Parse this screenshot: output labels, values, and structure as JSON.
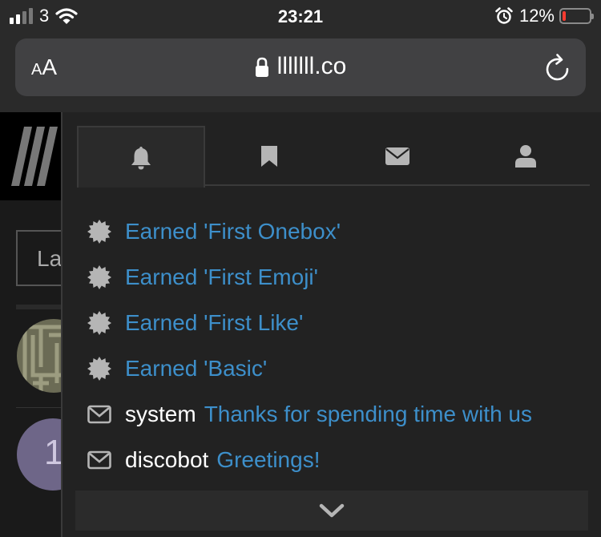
{
  "status_bar": {
    "carrier": "3",
    "time": "23:21",
    "battery_percent": "12%",
    "battery_level": 0.12,
    "signal_bars_active": 2,
    "signal_bars_total": 4
  },
  "browser": {
    "text_size_label_small": "A",
    "text_size_label_large": "A",
    "url": "lllllll.co"
  },
  "background_page": {
    "input_partial_text": "La",
    "avatar_number": "1"
  },
  "notifications_panel": {
    "tabs": [
      {
        "name": "notifications",
        "icon": "bell-icon",
        "active": true
      },
      {
        "name": "bookmarks",
        "icon": "bookmark-icon",
        "active": false
      },
      {
        "name": "messages",
        "icon": "envelope-icon",
        "active": false
      },
      {
        "name": "profile",
        "icon": "user-icon",
        "active": false
      }
    ],
    "items": [
      {
        "icon": "badge-icon",
        "user": "",
        "text": "Earned 'First Onebox'"
      },
      {
        "icon": "badge-icon",
        "user": "",
        "text": "Earned 'First Emoji'"
      },
      {
        "icon": "badge-icon",
        "user": "",
        "text": "Earned 'First Like'"
      },
      {
        "icon": "badge-icon",
        "user": "",
        "text": "Earned 'Basic'"
      },
      {
        "icon": "envelope-icon",
        "user": "system",
        "text": "Thanks for spending time with us"
      },
      {
        "icon": "envelope-icon",
        "user": "discobot",
        "text": "Greetings!"
      }
    ],
    "show_more_icon": "chevron-down-icon"
  },
  "colors": {
    "link": "#3d8fca",
    "battery_low": "#ff3b30",
    "icon_gray": "#b5b5b5",
    "panel_bg": "#222222"
  }
}
